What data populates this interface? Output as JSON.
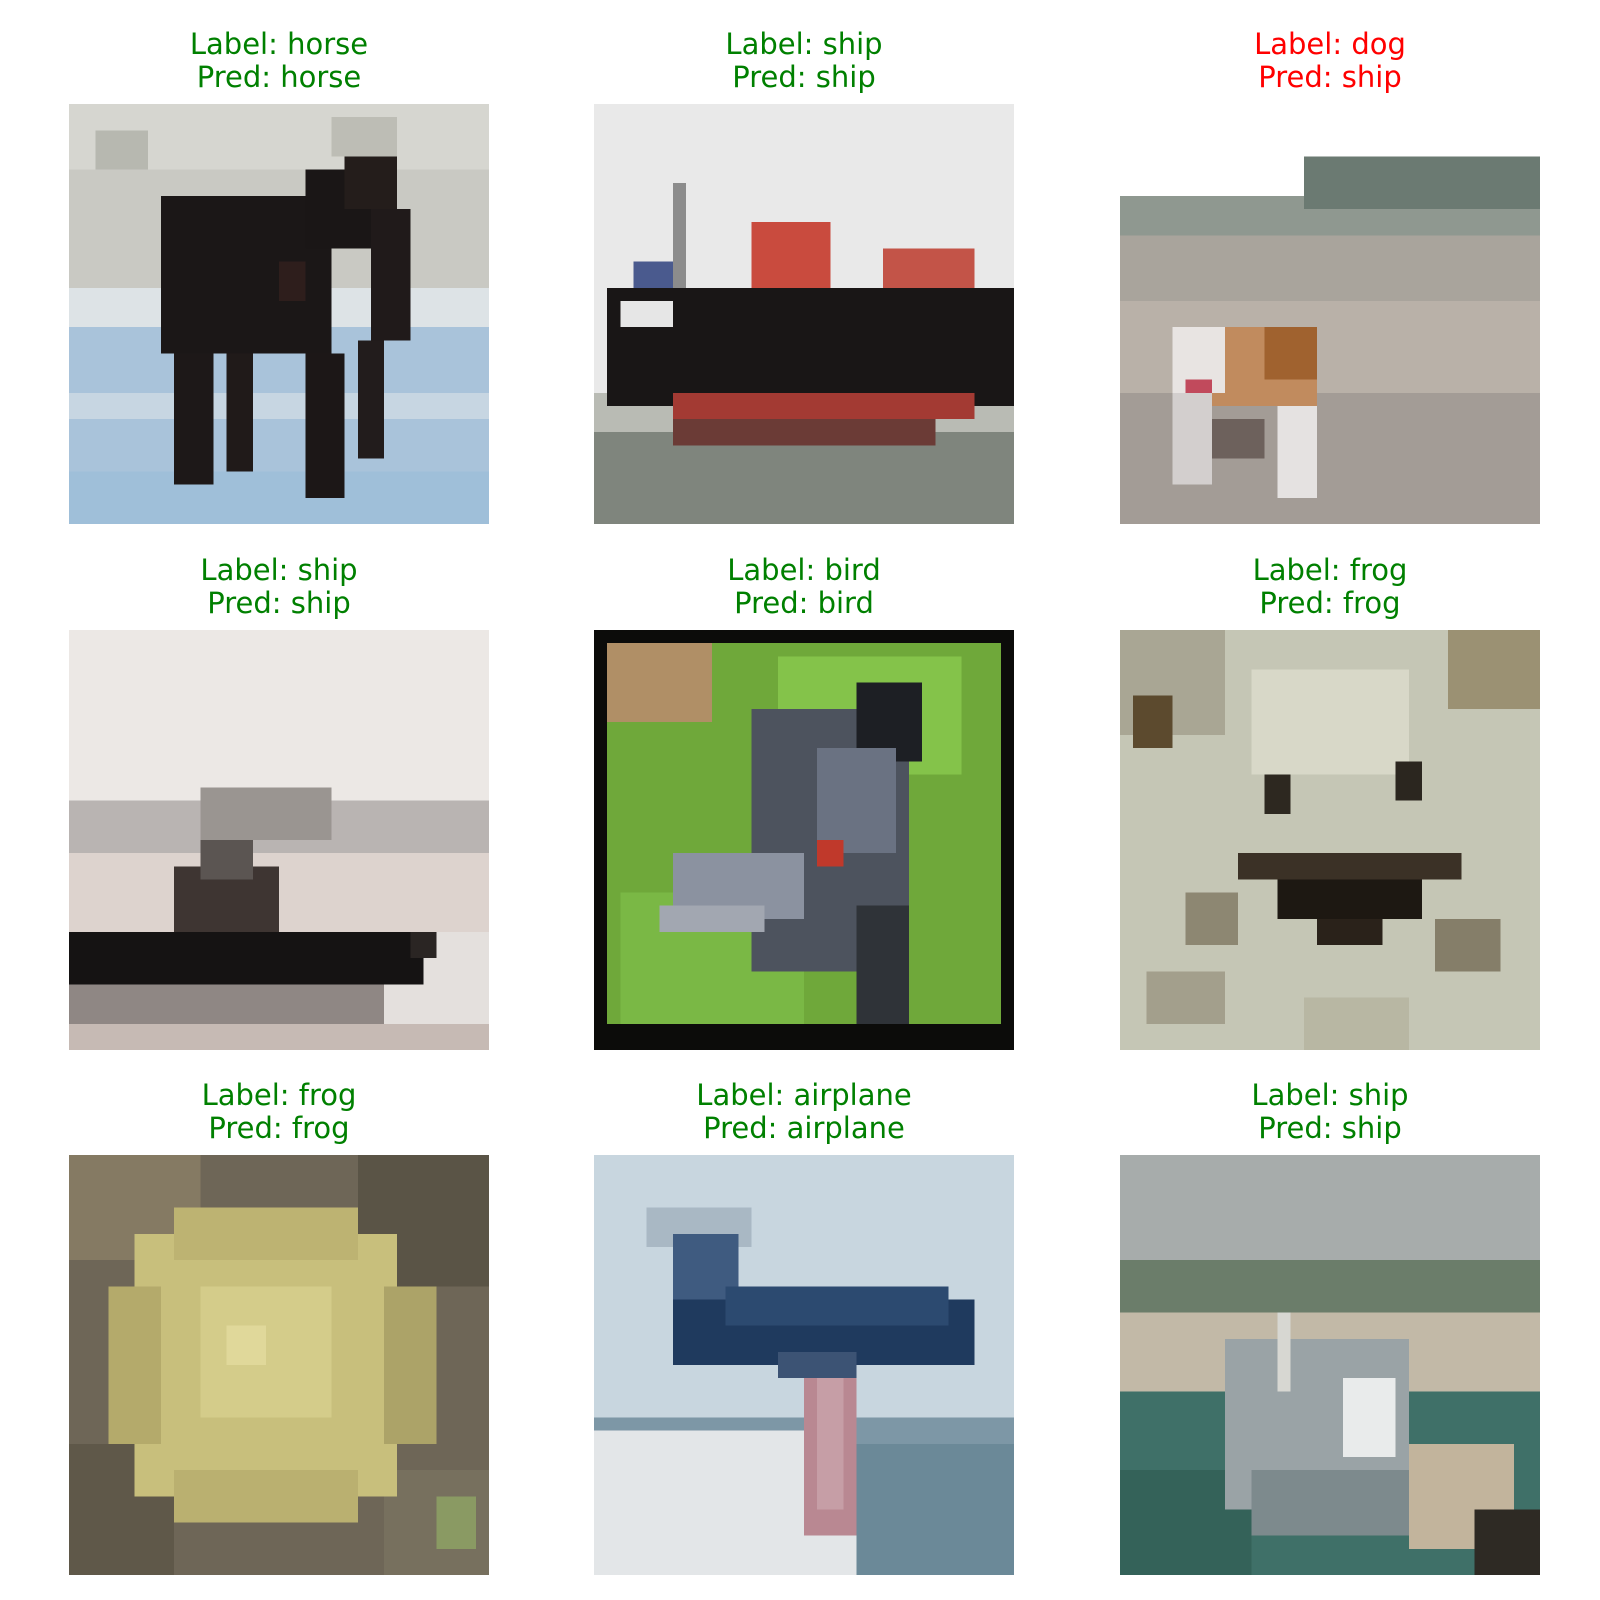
{
  "figure": {
    "colors": {
      "correct": "#008000",
      "incorrect": "#ff0000"
    },
    "samples": [
      {
        "label_text": "Label: horse",
        "pred_text": "Pred: horse",
        "correct": true,
        "scene": "horse"
      },
      {
        "label_text": "Label: ship",
        "pred_text": "Pred: ship",
        "correct": true,
        "scene": "cargo-ship"
      },
      {
        "label_text": "Label: dog",
        "pred_text": "Pred: ship",
        "correct": false,
        "scene": "dog-on-beach"
      },
      {
        "label_text": "Label: ship",
        "pred_text": "Pred: ship",
        "correct": true,
        "scene": "boat-in-fog"
      },
      {
        "label_text": "Label: bird",
        "pred_text": "Pred: bird",
        "correct": true,
        "scene": "bird-head"
      },
      {
        "label_text": "Label: frog",
        "pred_text": "Pred: frog",
        "correct": true,
        "scene": "frog-closeup"
      },
      {
        "label_text": "Label: frog",
        "pred_text": "Pred: frog",
        "correct": true,
        "scene": "frog-on-leaves"
      },
      {
        "label_text": "Label: airplane",
        "pred_text": "Pred: airplane",
        "correct": true,
        "scene": "airplane"
      },
      {
        "label_text": "Label: ship",
        "pred_text": "Pred: ship",
        "correct": true,
        "scene": "ship-in-harbor"
      }
    ]
  }
}
